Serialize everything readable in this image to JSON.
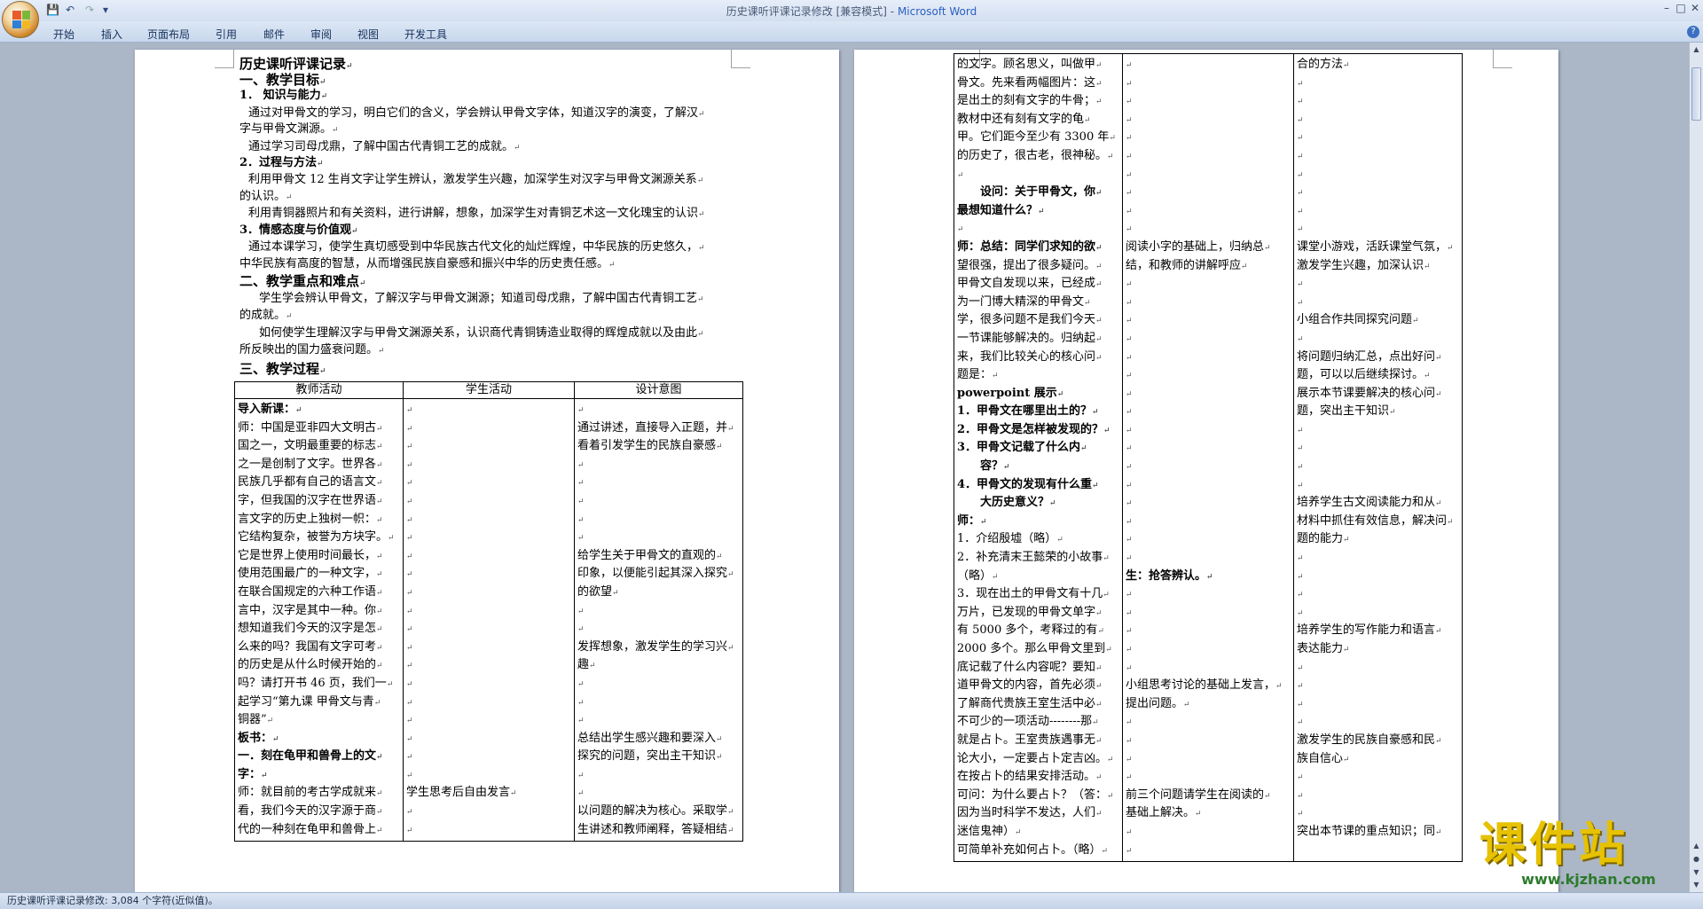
{
  "window": {
    "title_doc": "历史课听评课记录修改 [兼容模式] -",
    "title_app": "Microsoft Word"
  },
  "ribbon_tabs": [
    "开始",
    "插入",
    "页面布局",
    "引用",
    "邮件",
    "审阅",
    "视图",
    "开发工具"
  ],
  "status": {
    "text": "历史课听评课记录修改: 3,084 个字符(近似值)。"
  },
  "watermark": {
    "main": "课件站",
    "url": "www.kjzhan.com"
  },
  "page1": {
    "lines": [
      "历史课听评课记录",
      "一、教学目标",
      "1．      知识与能力",
      "通过对甲骨文的学习，明白它们的含义，学会辨认甲骨文字体，知道汉字的演变，了解汉",
      "字与甲骨文渊源。",
      "通过学习司母戊鼎，了解中国古代青铜工艺的成就。",
      "2．过程与方法",
      "利用甲骨文 12 生肖文字让学生辨认，激发学生兴趣，加深学生对汉字与甲骨文渊源关系",
      "的认识。",
      "利用青铜器照片和有关资料，进行讲解，想象，加深学生对青铜艺术这一文化瑰宝的认识",
      "3．情感态度与价值观",
      "通过本课学习，使学生真切感受到中华民族古代文化的灿烂辉煌，中华民族的历史悠久，",
      "中华民族有高度的智慧，从而增强民族自豪感和振兴中华的历史责任感。",
      "二、教学重点和难点",
      "学生学会辨认甲骨文，了解汉字与甲骨文渊源；知道司母戊鼎，了解中国古代青铜工艺",
      "的成就。",
      "如何使学生理解汉字与甲骨文渊源关系，认识商代青铜铸造业取得的辉煌成就以及由此",
      "所反映出的国力盛衰问题。",
      "三、教学过程"
    ],
    "table": {
      "headers": [
        "教师活动",
        "学生活动",
        "设计意图"
      ],
      "col1": [
        "导入新课：",
        "师：中国是亚非四大文明古",
        "国之一，文明最重要的标志",
        "之一是创制了文字。世界各",
        "民族几乎都有自己的语言文",
        "字，但我国的汉字在世界语",
        "言文字的历史上独树一帜：",
        "它结构复杂，被誉为方块字。",
        "它是世界上使用时间最长，",
        "使用范围最广的一种文字，",
        "在联合国规定的六种工作语",
        "言中，汉字是其中一种。你",
        "想知道我们今天的汉字是怎",
        "么来的吗？我国有文字可考",
        "的历史是从什么时候开始的",
        "吗？请打开书 46 页，我们一",
        "起学习“第九课 甲骨文与青",
        "铜器”",
        "板书：",
        "一．刻在龟甲和兽骨上的文",
        "字：",
        "师：就目前的考古学成就来",
        "看，我们今天的汉字源于商",
        "代的一种刻在龟甲和兽骨上"
      ],
      "col2": [
        "",
        "",
        "",
        "",
        "",
        "",
        "",
        "",
        "",
        "",
        "",
        "",
        "",
        "",
        "",
        "",
        "",
        "",
        "",
        "",
        "",
        "学生思考后自由发言",
        "",
        ""
      ],
      "col3": [
        "",
        "通过讲述，直接导入正题，并",
        "看着引发学生的民族自豪感",
        "",
        "",
        "",
        "",
        "",
        "给学生关于甲骨文的直观的",
        "印象，以便能引起其深入探究",
        "的欲望",
        "",
        "",
        "发挥想象，激发学生的学习兴",
        "趣",
        "",
        "",
        "",
        "总结出学生感兴趣和要深入",
        "探究的问题，突出主干知识",
        "",
        "",
        "以问题的解决为核心。采取学",
        "生讲述和教师阐释，答疑相结"
      ]
    }
  },
  "page2": {
    "table": {
      "col1": [
        "的文字。顾名思义，叫做甲",
        "骨文。先来看两幅图片：这",
        "是出土的刻有文字的牛骨；",
        "教材中还有刻有文字的龟",
        "甲。它们距今至少有 3300 年",
        "的历史了，很古老，很神秘。",
        "",
        "设问：关于甲骨文，你",
        "最想知道什么？",
        "",
        "师：总结：同学们求知的欲",
        "望很强，提出了很多疑问。",
        "甲骨文自发现以来，已经成",
        "为一门博大精深的甲骨文",
        "学，很多问题不是我们今天",
        "一节课能够解决的。归纳起",
        "来，我们比较关心的核心问",
        "题是：",
        "powerpoint 展示",
        "1．甲骨文在哪里出土的？",
        "2．甲骨文是怎样被发现的？",
        "3．甲骨文记载了什么内",
        "容？",
        "4．甲骨文的发现有什么重",
        "大历史意义？",
        "师：",
        "1．介绍殷墟（略）",
        "2．补充清末王懿荣的小故事",
        "（略）",
        "3．现在出土的甲骨文有十几",
        "万片，已发现的甲骨文单字",
        "有 5000 多个，考释过的有",
        "2000 多个。那么甲骨文里到",
        "底记载了什么内容呢？要知",
        "道甲骨文的内容，首先必须",
        "了解商代贵族王室生活中必",
        "不可少的一项活动--------那",
        "就是占卜。王室贵族遇事无",
        "论大小，一定要占卜定吉凶。",
        "在按占卜的结果安排活动。",
        "可问：为什么要占卜？（答：",
        "因为当时科学不发达，人们",
        "迷信鬼神）",
        "可简单补充如何占卜。（略）"
      ],
      "col2": [
        "",
        "",
        "",
        "",
        "",
        "",
        "",
        "",
        "",
        "",
        "阅读小字的基础上，归纳总",
        "结，和教师的讲解呼应",
        "",
        "",
        "",
        "",
        "",
        "",
        "",
        "",
        "",
        "",
        "",
        "",
        "",
        "",
        "",
        "",
        "生：抢答辨认。",
        "",
        "",
        "",
        "",
        "",
        "小组思考讨论的基础上发言，",
        "提出问题。",
        "",
        "",
        "",
        "",
        "前三个问题请学生在阅读的",
        "基础上解决。",
        "",
        ""
      ],
      "col3": [
        "合的方法",
        "",
        "",
        "",
        "",
        "",
        "",
        "",
        "",
        "",
        "课堂小游戏，活跃课堂气氛，",
        "激发学生兴趣，加深认识",
        "",
        "",
        "小组合作共同探究问题",
        "",
        "将问题归纳汇总，点出好问",
        "题，可以以后继续探讨。",
        "展示本节课要解决的核心问",
        "题，突出主干知识",
        "",
        "",
        "",
        "",
        "培养学生古文阅读能力和从",
        "材料中抓住有效信息，解决问",
        "题的能力",
        "",
        "",
        "",
        "",
        "培养学生的写作能力和语言",
        "表达能力",
        "",
        "",
        "",
        "",
        "激发学生的民族自豪感和民",
        "族自信心",
        "",
        "",
        "",
        "突出本节课的重点知识；同"
      ]
    }
  }
}
